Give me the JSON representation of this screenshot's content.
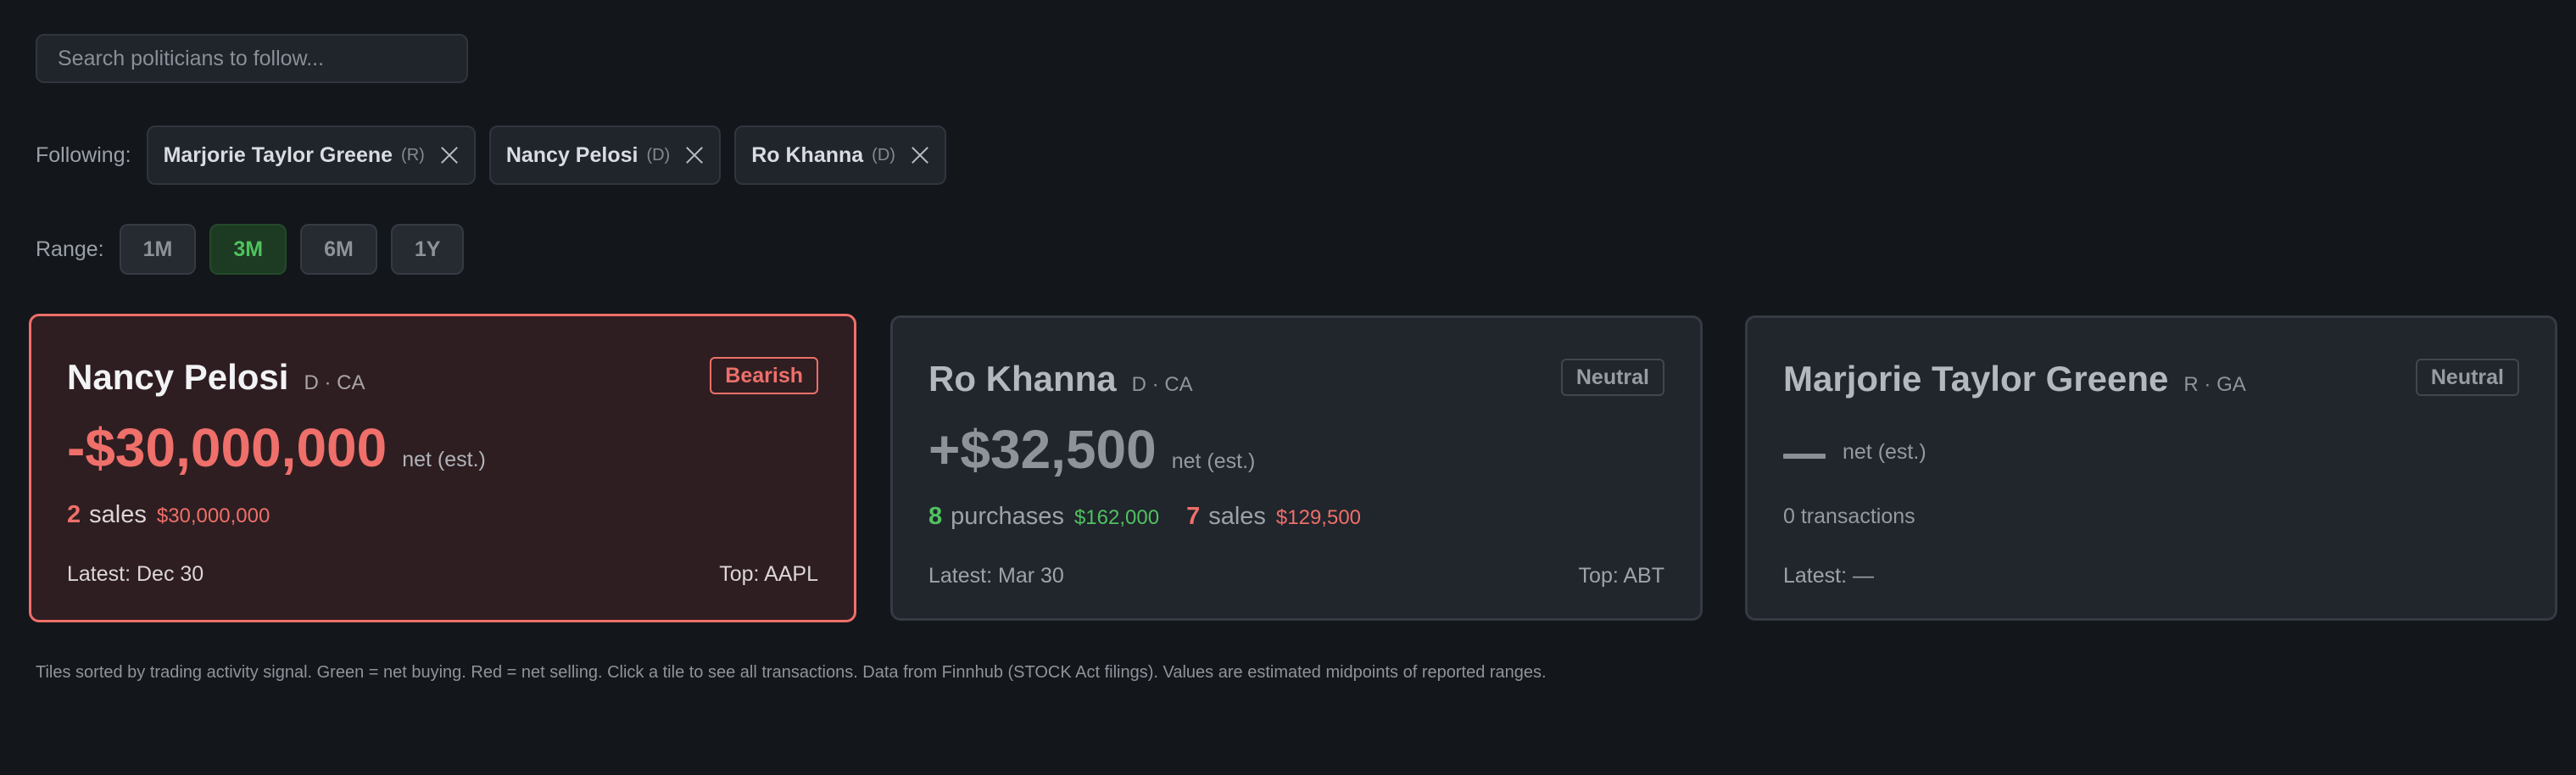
{
  "search": {
    "placeholder": "Search politicians to follow..."
  },
  "following": {
    "label": "Following:",
    "chips": [
      {
        "name": "Marjorie Taylor Greene",
        "party": "(R)"
      },
      {
        "name": "Nancy Pelosi",
        "party": "(D)"
      },
      {
        "name": "Ro Khanna",
        "party": "(D)"
      }
    ]
  },
  "range": {
    "label": "Range:",
    "options": [
      "1M",
      "3M",
      "6M",
      "1Y"
    ],
    "selected": "3M"
  },
  "cards": [
    {
      "name": "Nancy Pelosi",
      "meta": "D · CA",
      "signal": "Bearish",
      "net": "-$30,000,000",
      "net_label": "net (est.)",
      "sales_count": "2",
      "sales_word": "sales",
      "sales_amount": "$30,000,000",
      "latest": "Latest: Dec 30",
      "top": "Top: AAPL"
    },
    {
      "name": "Ro Khanna",
      "meta": "D · CA",
      "signal": "Neutral",
      "net": "+$32,500",
      "net_label": "net (est.)",
      "purchases_count": "8",
      "purchases_word": "purchases",
      "purchases_amount": "$162,000",
      "sales_count": "7",
      "sales_word": "sales",
      "sales_amount": "$129,500",
      "latest": "Latest: Mar 30",
      "top": "Top: ABT"
    },
    {
      "name": "Marjorie Taylor Greene",
      "meta": "R · GA",
      "signal": "Neutral",
      "net_label": "net (est.)",
      "transactions": "0 transactions",
      "latest": "Latest: —"
    }
  ],
  "footnote": "Tiles sorted by trading activity signal. Green = net buying. Red = net selling. Click a tile to see all transactions. Data from Finnhub (STOCK Act filings). Values are estimated midpoints of reported ranges.",
  "colors": {
    "bearish": "#ef6f6a",
    "bullish": "#4fc25f",
    "background": "#13161b"
  }
}
